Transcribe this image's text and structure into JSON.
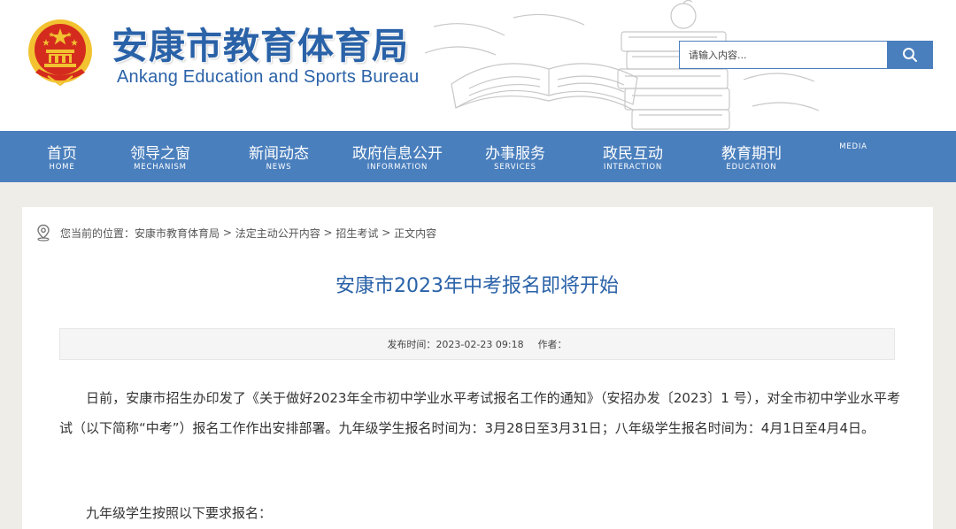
{
  "header": {
    "title": "安康市教育体育局",
    "subtitle": "Ankang Education and Sports Bureau",
    "search_placeholder": "请输入内容..."
  },
  "nav": {
    "items": [
      {
        "cn": "首页",
        "en": "HOME"
      },
      {
        "cn": "领导之窗",
        "en": "MECHANISM"
      },
      {
        "cn": "新闻动态",
        "en": "NEWS"
      },
      {
        "cn": "政府信息公开",
        "en": "INFORMATION"
      },
      {
        "cn": "办事服务",
        "en": "SERVICES"
      },
      {
        "cn": "政民互动",
        "en": "INTERACTION"
      },
      {
        "cn": "教育期刊",
        "en": "EDUCATION"
      },
      {
        "cn": "",
        "en": "MEDIA"
      }
    ]
  },
  "breadcrumb": {
    "prefix": "您当前的位置：",
    "items": [
      "安康市教育体育局",
      "法定主动公开内容",
      "招生考试",
      "正文内容"
    ],
    "separator": " > "
  },
  "article": {
    "title": "安康市2023年中考报名即将开始",
    "publish_label": "发布时间：",
    "publish_time": "2023-02-23 09:18",
    "author_label": "作者：",
    "author": "",
    "paragraphs": [
      "日前，安康市招生办印发了《关于做好2023年全市初中学业水平考试报名工作的通知》（安招办发〔2023〕1 号），对全市初中学业水平考试（以下简称“中考”）报名工作作出安排部署。九年级学生报名时间为：3月28日至3月31日；八年级学生报名时间为：4月1日至4月4日。",
      "九年级学生按照以下要求报名："
    ]
  },
  "colors": {
    "brand_blue": "#2a62a8",
    "nav_blue": "#4a7fbd",
    "emblem_red": "#d42b1e",
    "emblem_gold": "#f2c230"
  },
  "icons": [
    "national-emblem-icon",
    "search-icon",
    "location-pin-icon"
  ]
}
